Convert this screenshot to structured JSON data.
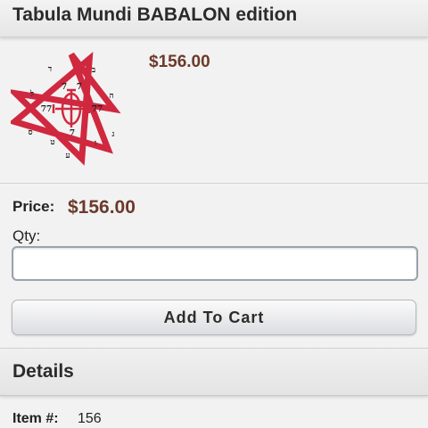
{
  "product": {
    "title": "Tabula Mundi BABALON edition",
    "image_price": "$156.00",
    "image": {
      "description_icon": "heptagram-seal-icon",
      "glyphs": [
        "ד",
        "ב",
        "ה",
        "7",
        "7",
        "77",
        "77",
        "7",
        "ל",
        "ס",
        "ג",
        "ע",
        "ט",
        "ו"
      ]
    }
  },
  "purchase": {
    "price_label": "Price:",
    "price_value": "$156.00",
    "qty_label": "Qty:",
    "qty_value": "",
    "add_to_cart_label": "Add To Cart"
  },
  "details": {
    "heading": "Details",
    "item_label": "Item #:",
    "item_value": "156"
  },
  "colors": {
    "price": "#6b3a2a",
    "star": "#d0283f"
  }
}
